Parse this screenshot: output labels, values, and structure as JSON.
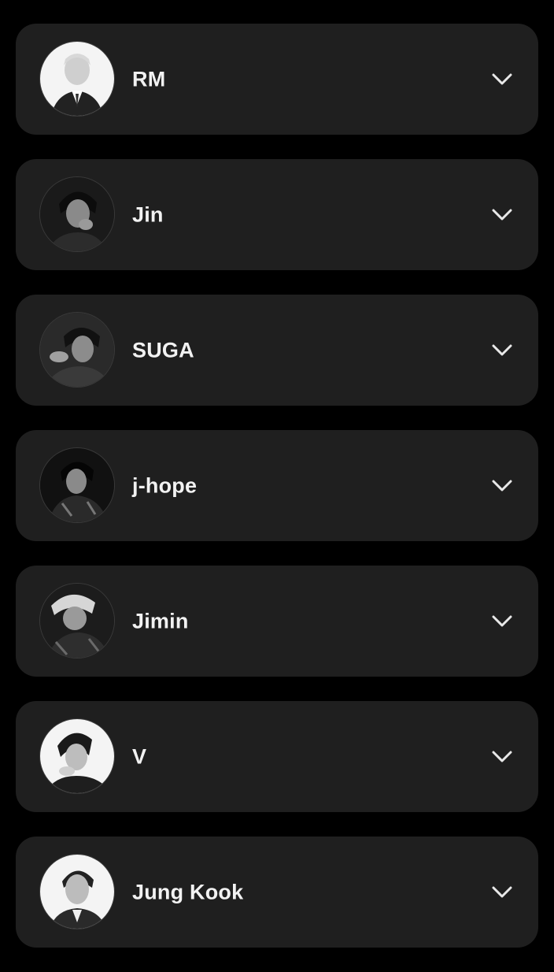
{
  "members": [
    {
      "id": "rm",
      "name": "RM",
      "avatar": "light"
    },
    {
      "id": "jin",
      "name": "Jin",
      "avatar": "dark"
    },
    {
      "id": "suga",
      "name": "SUGA",
      "avatar": "dark"
    },
    {
      "id": "j-hope",
      "name": "j-hope",
      "avatar": "dark"
    },
    {
      "id": "jimin",
      "name": "Jimin",
      "avatar": "dark"
    },
    {
      "id": "v",
      "name": "V",
      "avatar": "light"
    },
    {
      "id": "jung-kook",
      "name": "Jung Kook",
      "avatar": "light"
    }
  ],
  "icons": {
    "expand": "chevron-down-icon"
  },
  "colors": {
    "background": "#000000",
    "card": "#1f1f1f",
    "text": "#f2f2f2",
    "chevron": "#e8e8e8"
  }
}
